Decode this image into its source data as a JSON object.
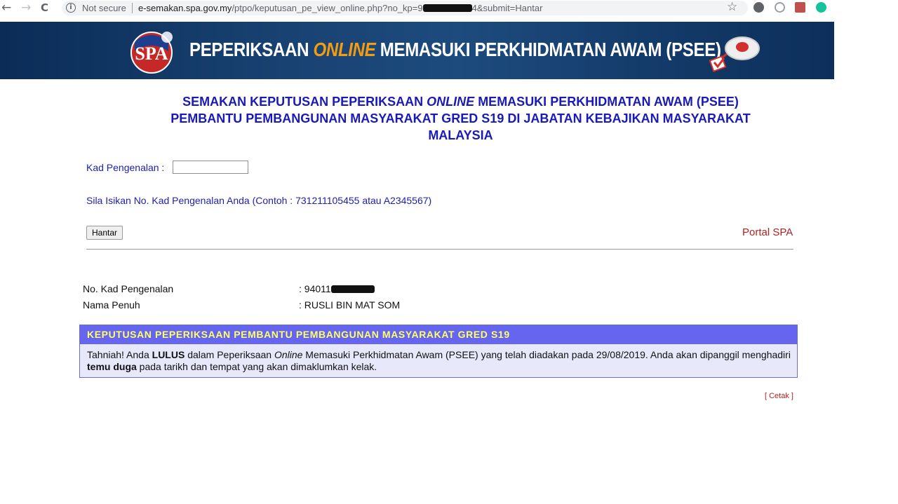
{
  "browser": {
    "back": "←",
    "forward": "→",
    "reload": "C",
    "security": "Not secure",
    "url_host": "e-semakan.spa.gov.my",
    "url_path_before": "/ptpo/keputusan_pe_view_online.php?no_kp=9",
    "url_path_after": "4&submit=Hantar",
    "star": "☆",
    "extension_icons": [
      "extension-m-icon",
      "globe-icon",
      "pdf-icon",
      "grammarly-icon"
    ]
  },
  "banner": {
    "title_pre": "PEPERIKSAAN ",
    "title_hl": "ONLINE",
    "title_post": " MEMASUKI PERKHIDMATAN AWAM (PSEE)",
    "logo_text": "SPA"
  },
  "heading": {
    "line1_pre": "SEMAKAN KEPUTUSAN PEPERIKSAAN ",
    "line1_em": "ONLINE",
    "line1_post": " MEMASUKI PERKHIDMATAN AWAM (PSEE)",
    "line2": "PEMBANTU PEMBANGUNAN MASYARAKAT GRED S19 DI JABATAN KEBAJIKAN MASYARAKAT",
    "line3": "MALAYSIA"
  },
  "form": {
    "kp_label": "Kad Pengenalan :",
    "kp_value": "",
    "hint": "Sila Isikan No. Kad Pengenalan Anda (Contoh : 731211105455 atau A2345567)",
    "submit_label": "Hantar",
    "portal_link": "Portal SPA"
  },
  "candidate": {
    "ic_label": "No. Kad Pengenalan",
    "ic_value": ":  94011",
    "name_label": "Nama Penuh",
    "name_value": ":  RUSLI BIN MAT SOM"
  },
  "result": {
    "header": "KEPUTUSAN PEPERIKSAAN PEMBANTU PEMBANGUNAN MASYARAKAT GRED S19",
    "p1": "Tahniah! Anda ",
    "p2": "LULUS",
    "p3": " dalam Peperiksaan ",
    "p4": "Online",
    "p5": " Memasuki Perkhidmatan Awam (PSEE) yang telah diadakan pada 29/08/2019. Anda akan dipanggil menghadiri ",
    "p6": "temu duga",
    "p7": " pada tarikh dan tempat yang akan dimaklumkan kelak."
  },
  "print_link": "[ Cetak ]",
  "colors": {
    "heading": "#1a1ab8",
    "result_header_bg": "#6565f0",
    "result_header_text": "#ffff66",
    "link_red": "#b22222"
  }
}
